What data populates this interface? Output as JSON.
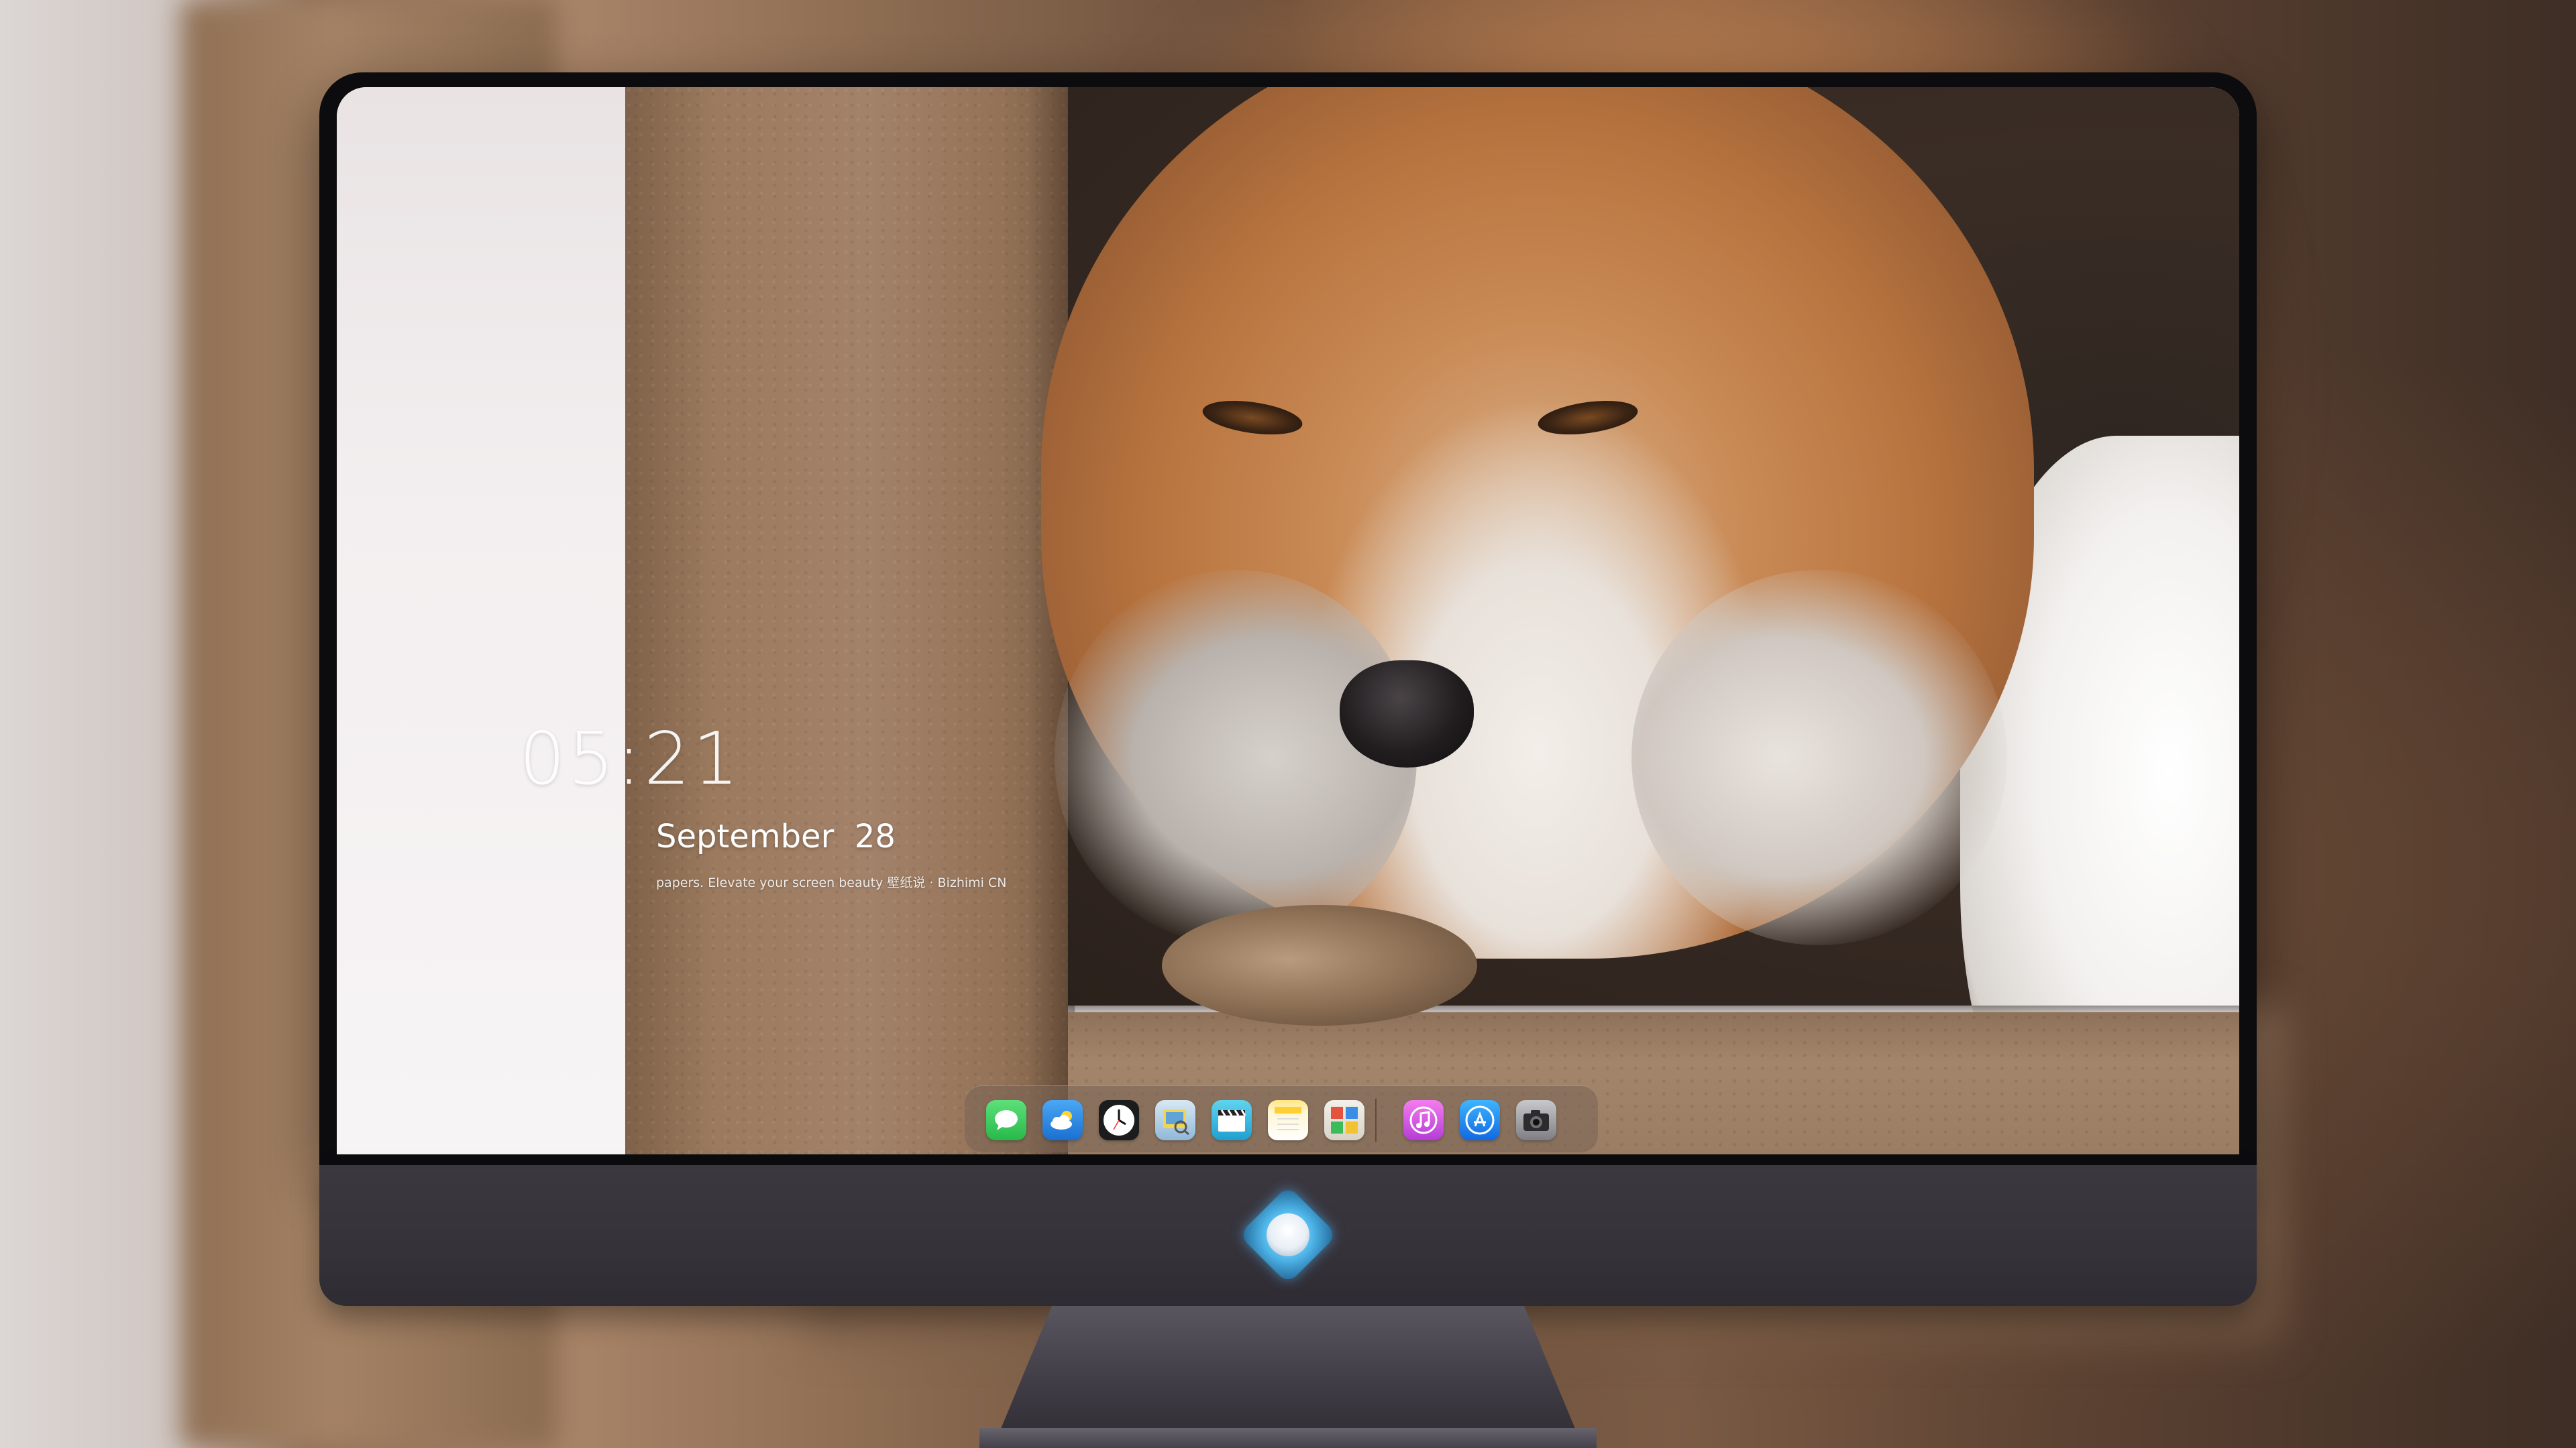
{
  "lock_screen": {
    "time": "05:21",
    "date": "September  28",
    "credit": "papers. Elevate your screen beauty 壁纸说 · Bizhimi CN"
  },
  "dock": {
    "apps": [
      {
        "name": "Messages",
        "icon": "messages-icon",
        "color": "#34c759"
      },
      {
        "name": "Weather",
        "icon": "weather-icon",
        "color": "#2f8fe8"
      },
      {
        "name": "Clock",
        "icon": "clock-icon",
        "color": "#1c1c1e"
      },
      {
        "name": "Preview",
        "icon": "preview-icon",
        "color": "#6aa8d8"
      },
      {
        "name": "Final Cut",
        "icon": "clapperboard-icon",
        "color": "#3fb9e0"
      },
      {
        "name": "Notes",
        "icon": "notes-icon",
        "color": "#ffd54a"
      },
      {
        "name": "Photo Booth",
        "icon": "photo-booth-icon",
        "color": "#d84a3a"
      },
      {
        "name": "iTunes",
        "icon": "music-icon",
        "color": "#d94bd8"
      },
      {
        "name": "App Store",
        "icon": "app-store-icon",
        "color": "#1e8ff0"
      },
      {
        "name": "Camera",
        "icon": "camera-icon",
        "color": "#8e8e93"
      }
    ]
  },
  "colors": {
    "monitor_bezel": "#0c0c0e",
    "monitor_chin": "#3a363e",
    "accent_logo": "#4fb6ea"
  }
}
